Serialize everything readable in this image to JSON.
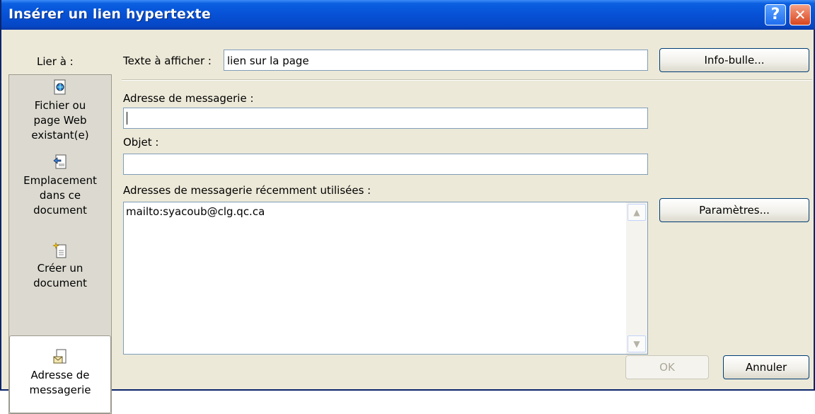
{
  "window": {
    "title": "Insérer un lien hypertexte",
    "help_glyph": "?",
    "close_glyph": "✕"
  },
  "link_to": {
    "label": "Lier à :",
    "items": [
      {
        "line1": "Fichier ou",
        "line2": "page Web",
        "line3": "existant(e)",
        "icon": "file-web-icon"
      },
      {
        "line1": "Emplacement",
        "line2": "dans ce",
        "line3": "document",
        "icon": "document-place-icon"
      },
      {
        "line1": "Créer un",
        "line2": "document",
        "icon": "new-document-icon"
      },
      {
        "line1": "Adresse de",
        "line2": "messagerie",
        "icon": "email-address-icon",
        "selected": true
      }
    ]
  },
  "form": {
    "display_text_label": "Texte à afficher :",
    "display_text_value": "lien sur la page",
    "email_label": "Adresse de messagerie :",
    "email_value": "",
    "subject_label": "Objet :",
    "subject_value": "",
    "recent_label": "Adresses de messagerie récemment utilisées :",
    "recent_items": [
      "mailto:syacoub@clg.qc.ca"
    ]
  },
  "buttons": {
    "tooltip": "Info-bulle...",
    "settings": "Paramètres...",
    "ok": "OK",
    "cancel": "Annuler"
  },
  "colors": {
    "title_bar": "#0751d6",
    "dialog_bg": "#ece9d8",
    "close_button": "#d8461f"
  }
}
